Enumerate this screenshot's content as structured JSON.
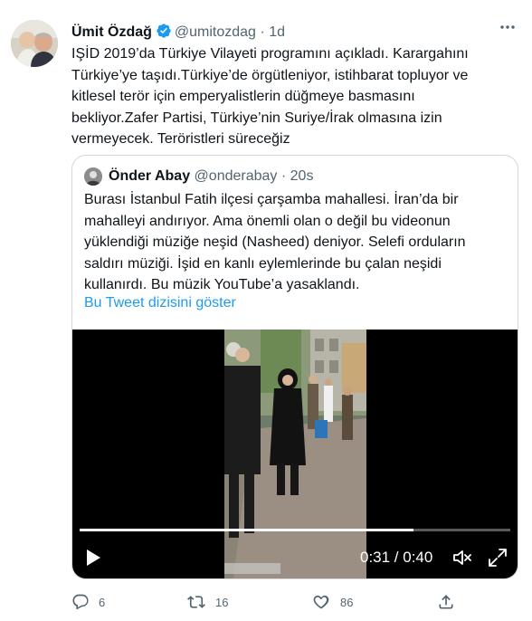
{
  "colors": {
    "accent": "#1d9bf0",
    "text": "#0f1419",
    "muted": "#536471",
    "border": "#cfd9de"
  },
  "tweet": {
    "author_name": "Ümit Özdağ",
    "handle": "@umitozdag",
    "separator": "·",
    "time": "1d",
    "verified_icon": "verified-badge-icon",
    "lines": [
      "IŞİD 2019’da Türkiye Vilayeti programını açıkladı. Karargahını",
      "Türkiye’ye taşıdı.Türkiye’de örgütleniyor, istihbarat topluyor ve",
      "kitlesel terör için emperyalistlerin düğmeye basmasını",
      "bekliyor.Zafer Partisi, Türkiye’nin Suriye/İrak olmasına izin",
      "vermeyecek. Teröristleri süreceğiz"
    ]
  },
  "quote": {
    "author_name": "Önder Abay",
    "handle": "@onderabay",
    "separator": "·",
    "time": "20s",
    "lines": [
      "Burası İstanbul Fatih ilçesi çarşamba mahallesi. İran’da bir",
      "mahalleyi andırıyor. Ama önemli olan o değil bu videonun",
      "yüklendiği müziğe neşid (Nasheed) deniyor. Selefi orduların",
      "saldırı müziği. İşid en kanlı eylemlerinde bu çalan neşidi",
      "kullanırdı. Bu müzik YouTube’a yasaklandı."
    ],
    "thread_link": "Bu Tweet dizisini göster",
    "video": {
      "time_display": "0:31 / 0:40",
      "progress": 0.775,
      "icons": [
        "play-icon",
        "volume-icon",
        "fullscreen-icon"
      ]
    }
  },
  "actions": {
    "reply_count": "6",
    "retweet_count": "16",
    "like_count": "86",
    "icons": [
      "reply-icon",
      "retweet-icon",
      "like-icon",
      "share-icon"
    ]
  }
}
